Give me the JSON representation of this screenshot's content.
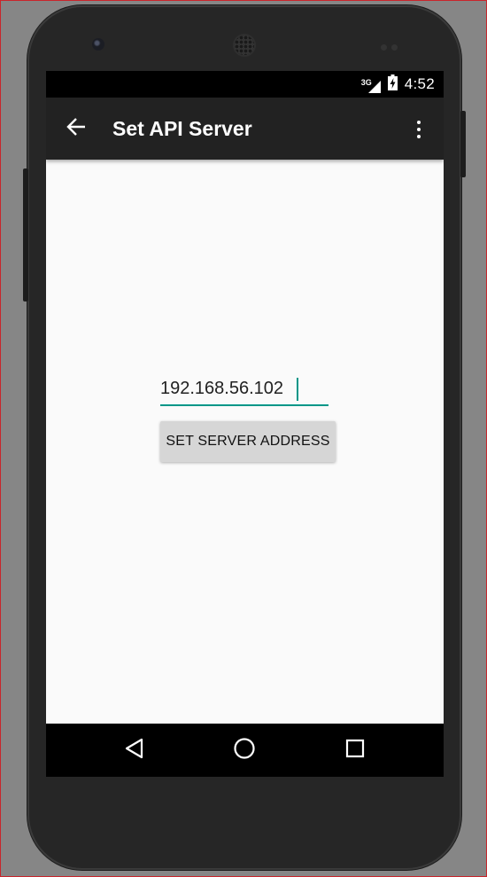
{
  "status_bar": {
    "network_label": "3G",
    "time": "4:52",
    "icons": [
      "signal-icon",
      "battery-charging-icon"
    ]
  },
  "app_bar": {
    "title": "Set API Server",
    "icons": [
      "back-arrow-icon",
      "overflow-menu-icon"
    ]
  },
  "form": {
    "server_address_value": "192.168.56.102",
    "set_button_label": "SET SERVER ADDRESS"
  },
  "nav_bar": {
    "icons": [
      "nav-back-icon",
      "nav-home-icon",
      "nav-recents-icon"
    ]
  },
  "colors": {
    "accent": "#009688",
    "app_bar": "#222222",
    "background": "#fafafa",
    "button": "#d6d6d6"
  }
}
